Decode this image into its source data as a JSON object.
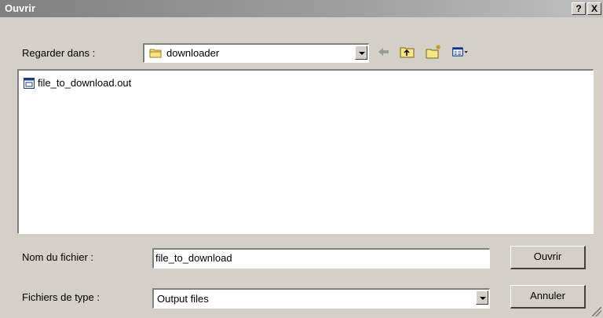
{
  "window": {
    "title": "Ouvrir",
    "help_label": "?",
    "close_label": "X"
  },
  "lookin": {
    "label": "Regarder dans :",
    "value": "downloader",
    "icon": "folder-icon"
  },
  "toolbar": {
    "icons": [
      "back-arrow-icon",
      "up-folder-icon",
      "new-folder-icon",
      "view-menu-icon"
    ]
  },
  "files": [
    {
      "name": "file_to_download.out",
      "icon": "file-icon"
    }
  ],
  "filename": {
    "label": "Nom du fichier :",
    "value": "file_to_download"
  },
  "filetype": {
    "label": "Fichiers de type :",
    "value": "Output files"
  },
  "buttons": {
    "open": "Ouvrir",
    "cancel": "Annuler"
  }
}
